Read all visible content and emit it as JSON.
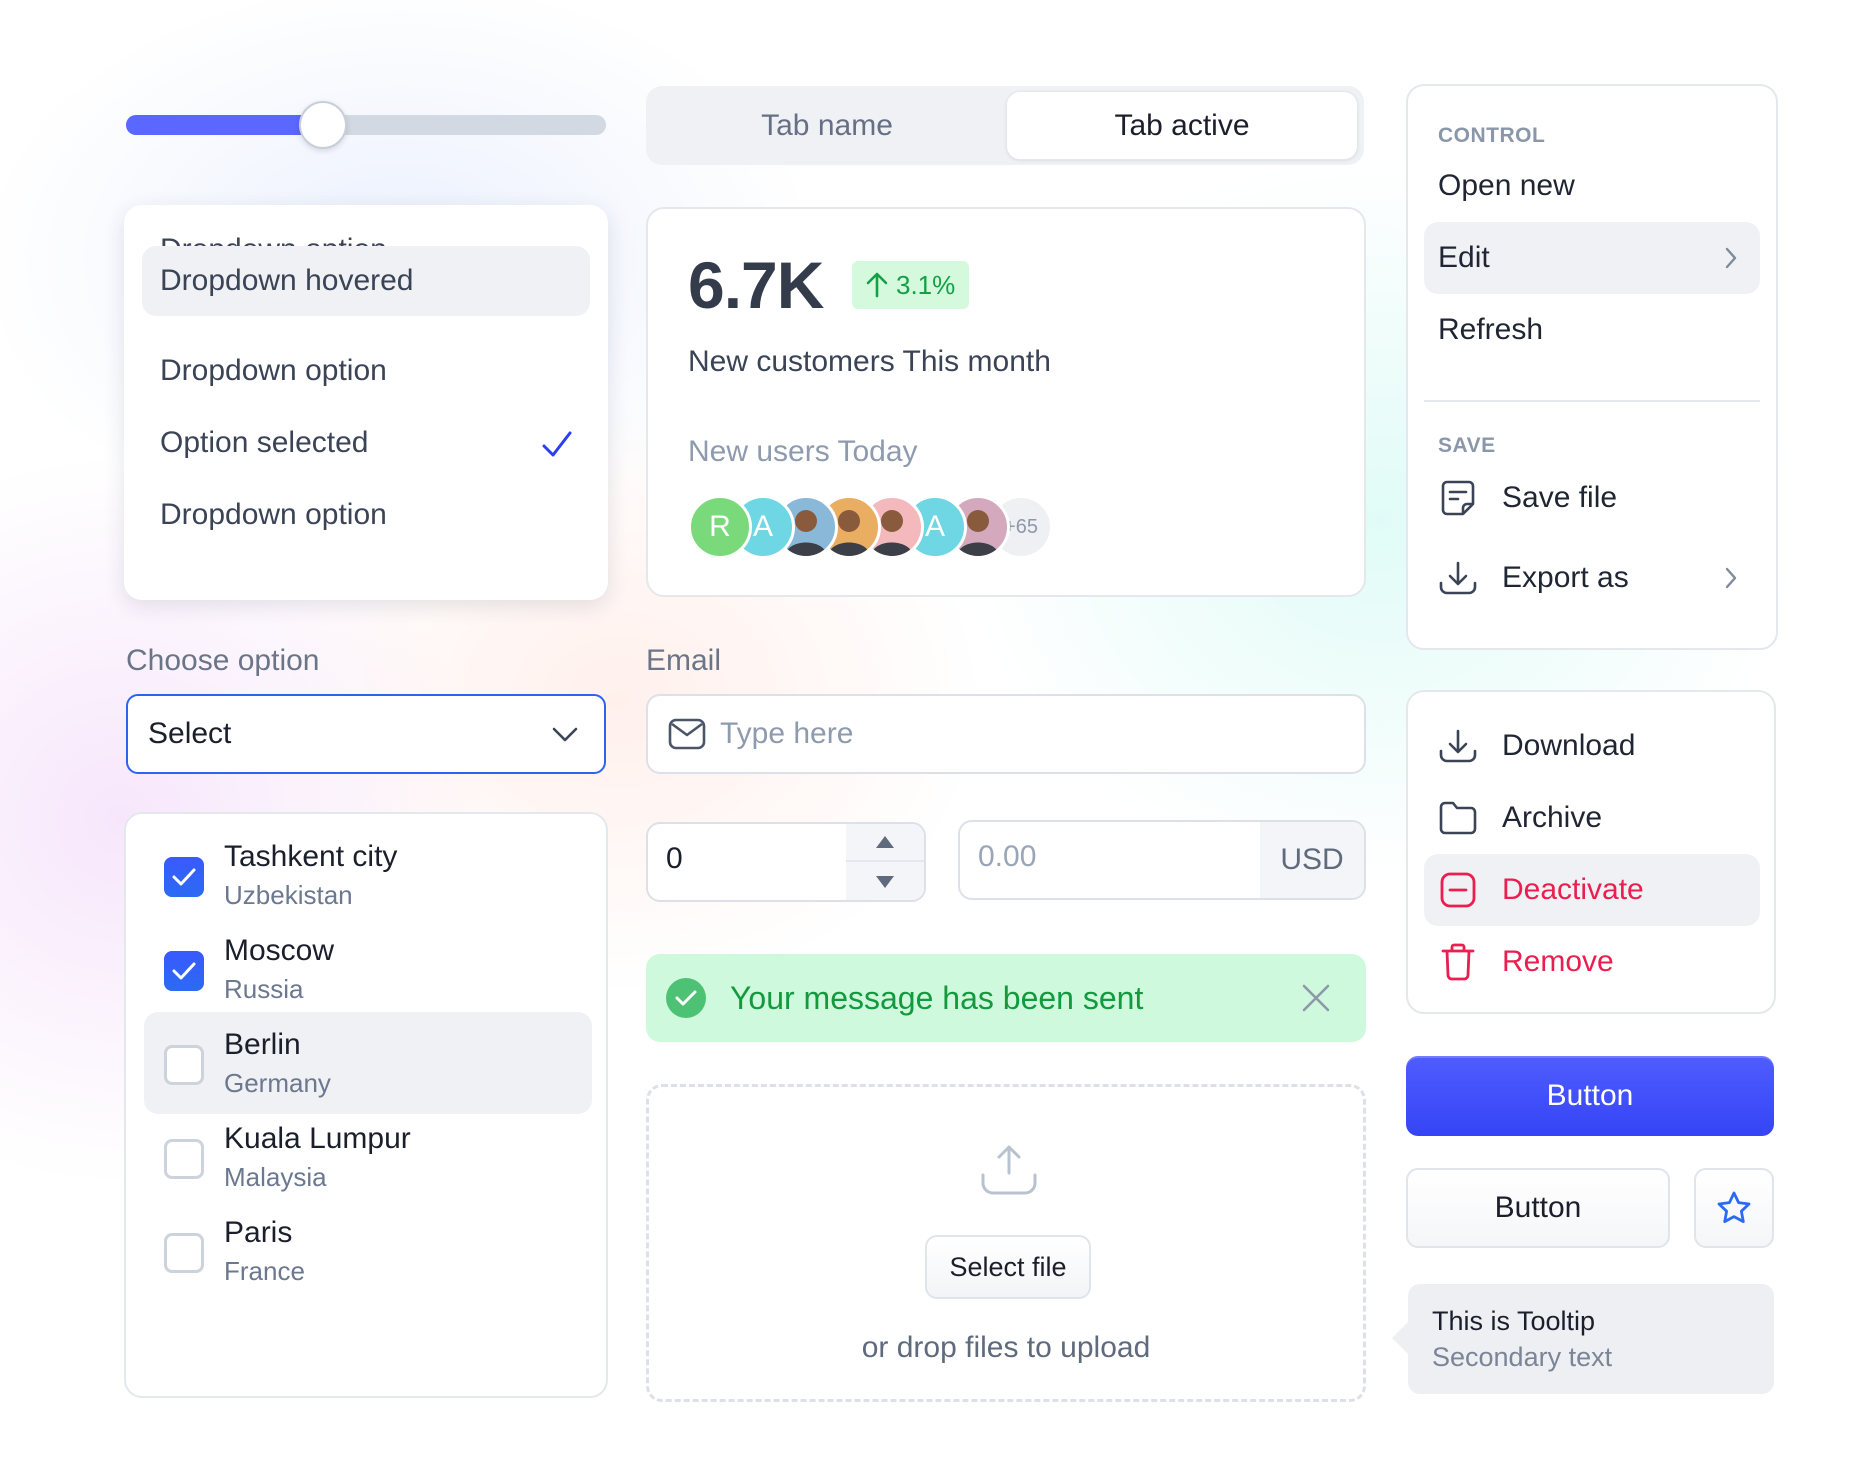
{
  "slider": {
    "value_percent": 41,
    "fill_color": "#5a68ff"
  },
  "dropdown": {
    "options": [
      {
        "label": "Dropdown option",
        "state": "default"
      },
      {
        "label": "Dropdown hovered",
        "state": "hovered"
      },
      {
        "label": "Dropdown option",
        "state": "default"
      },
      {
        "label": "Option selected",
        "state": "selected",
        "icon": "check-icon"
      },
      {
        "label": "Dropdown option",
        "state": "default"
      }
    ]
  },
  "tabs": [
    {
      "label": "Tab name",
      "active": false
    },
    {
      "label": "Tab active",
      "active": true
    }
  ],
  "stats": {
    "value": "6.7K",
    "change": "3.1%",
    "change_icon": "arrow-up-icon",
    "change_color": "#14a146",
    "label": "New customers This month",
    "sub_label": "New users Today",
    "avatars": [
      {
        "type": "initial",
        "text": "R",
        "color": "#7ad97a"
      },
      {
        "type": "initial",
        "text": "A",
        "color": "#6fd6e3"
      },
      {
        "type": "photo",
        "color": "#8ab8d8"
      },
      {
        "type": "photo",
        "color": "#e9ae62"
      },
      {
        "type": "photo",
        "color": "#f3b9bd"
      },
      {
        "type": "initial",
        "text": "A",
        "color": "#6fd6e3"
      },
      {
        "type": "photo",
        "color": "#d4a9bd"
      }
    ],
    "more_count": "+65"
  },
  "menu_control": {
    "section_title": "CONTROL",
    "items": [
      {
        "label": "Open new"
      },
      {
        "label": "Edit",
        "submenu": true,
        "hovered": true
      },
      {
        "label": "Refresh"
      }
    ],
    "save_section_title": "SAVE",
    "save_items": [
      {
        "label": "Save file",
        "icon": "file-note-icon"
      },
      {
        "label": "Export as",
        "icon": "download-icon",
        "submenu": true
      }
    ]
  },
  "menu_actions": {
    "items": [
      {
        "label": "Download",
        "icon": "download-icon"
      },
      {
        "label": "Archive",
        "icon": "folder-icon"
      },
      {
        "label": "Deactivate",
        "icon": "minus-square-icon",
        "danger": true,
        "hovered": true
      },
      {
        "label": "Remove",
        "icon": "trash-icon",
        "danger": true
      }
    ],
    "danger_color": "#ea1e4f"
  },
  "select_field": {
    "label": "Choose option",
    "value": "Select"
  },
  "email_field": {
    "label": "Email",
    "placeholder": "Type here",
    "value": ""
  },
  "locations": [
    {
      "city": "Tashkent city",
      "country": "Uzbekistan",
      "checked": true
    },
    {
      "city": "Moscow",
      "country": "Russia",
      "checked": true
    },
    {
      "city": "Berlin",
      "country": "Germany",
      "checked": false,
      "hovered": true
    },
    {
      "city": "Kuala Lumpur",
      "country": "Malaysia",
      "checked": false
    },
    {
      "city": "Paris",
      "country": "France",
      "checked": false
    }
  ],
  "number_input": {
    "value": "0"
  },
  "currency_input": {
    "placeholder": "0.00",
    "unit": "USD"
  },
  "toast": {
    "message": "Your message has been sent",
    "type": "success"
  },
  "upload": {
    "button_label": "Select file",
    "hint": "or drop files to upload"
  },
  "buttons": {
    "primary_label": "Button",
    "secondary_label": "Button",
    "icon_button": "star-icon",
    "primary_color": "#3d4dfa"
  },
  "tooltip": {
    "title": "This is Tooltip",
    "secondary": "Secondary text"
  }
}
